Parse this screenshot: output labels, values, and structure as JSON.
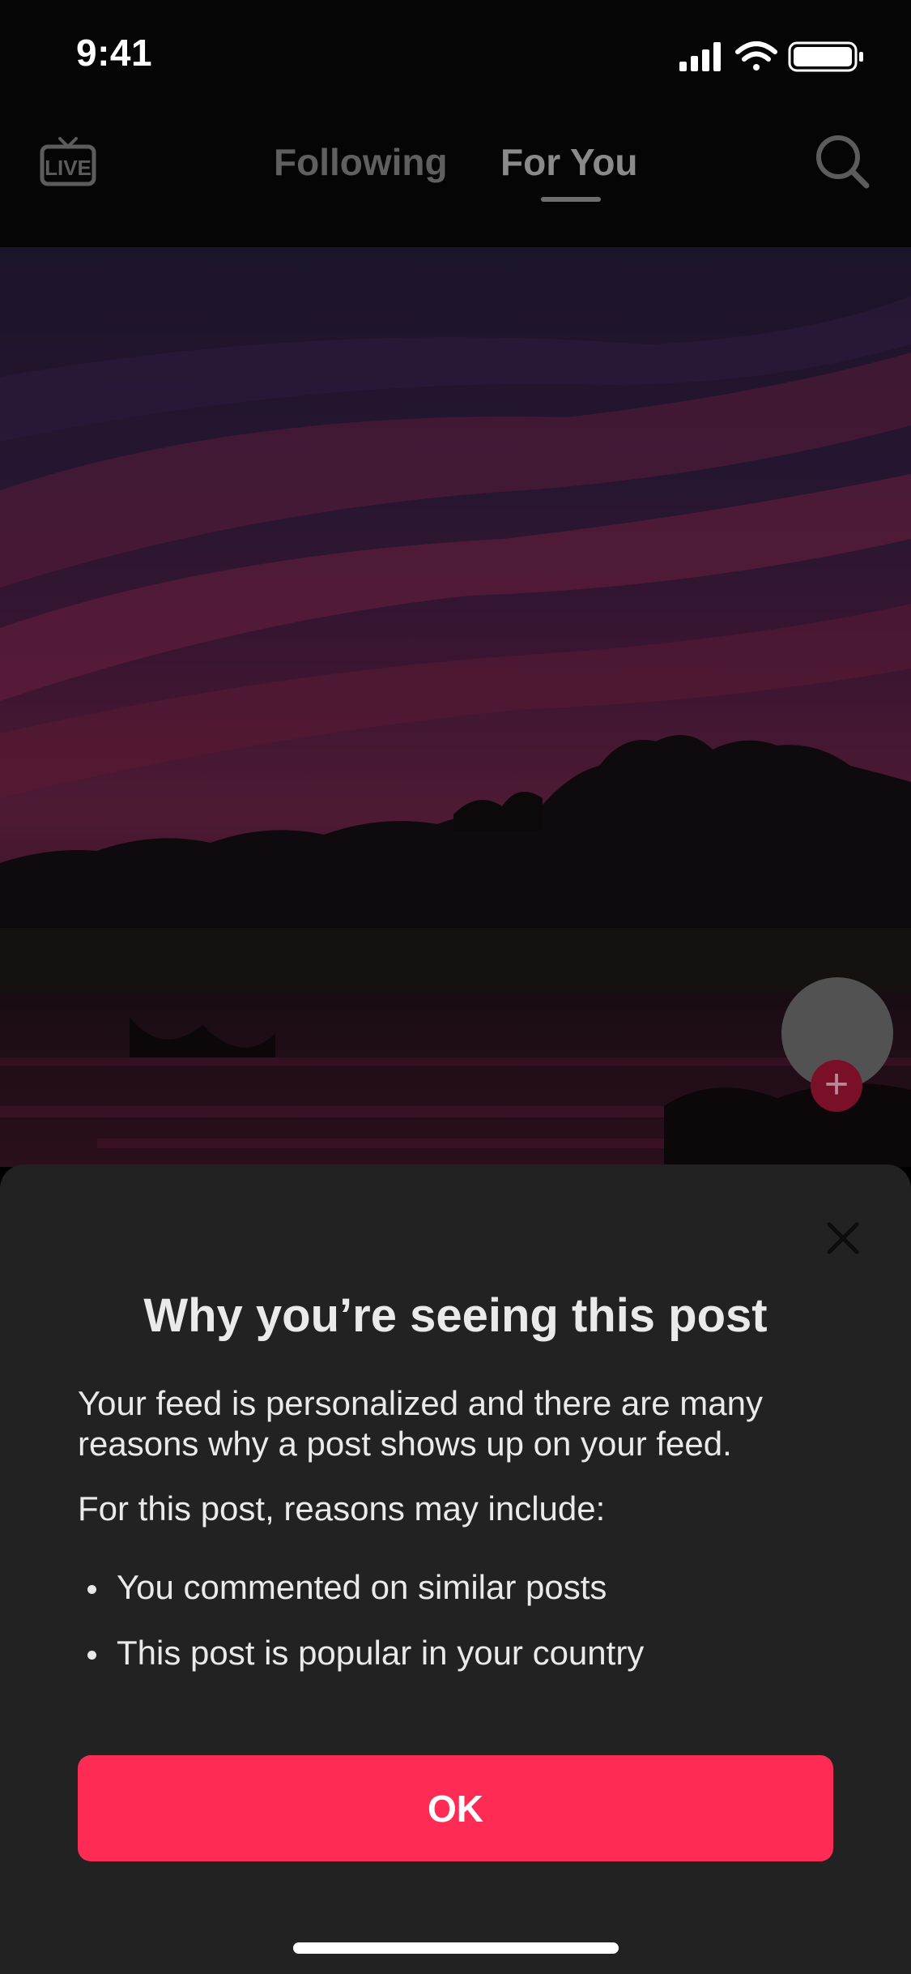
{
  "status_bar": {
    "time": "9:41",
    "icons": [
      "cellular-signal-icon",
      "wifi-icon",
      "battery-icon"
    ]
  },
  "top_nav": {
    "live_label": "LIVE",
    "tabs": [
      {
        "label": "Following",
        "active": false
      },
      {
        "label": "For You",
        "active": true
      }
    ],
    "search_icon": "search-icon"
  },
  "feed": {
    "background": "sunset-over-lake-photo",
    "follow_icon": "plus-icon"
  },
  "sheet": {
    "title": "Why you’re seeing this post",
    "paragraph1": "Your feed is personalized and there are many reasons why a post shows up on your feed.",
    "paragraph2": "For this post, reasons may include:",
    "reasons": [
      "You commented on similar posts",
      "This post is popular in your country"
    ],
    "ok_label": "OK",
    "close_icon": "close-icon"
  },
  "colors": {
    "accent": "#fe2c55",
    "sheet_background": "#222223",
    "text": "#eaeaea"
  }
}
